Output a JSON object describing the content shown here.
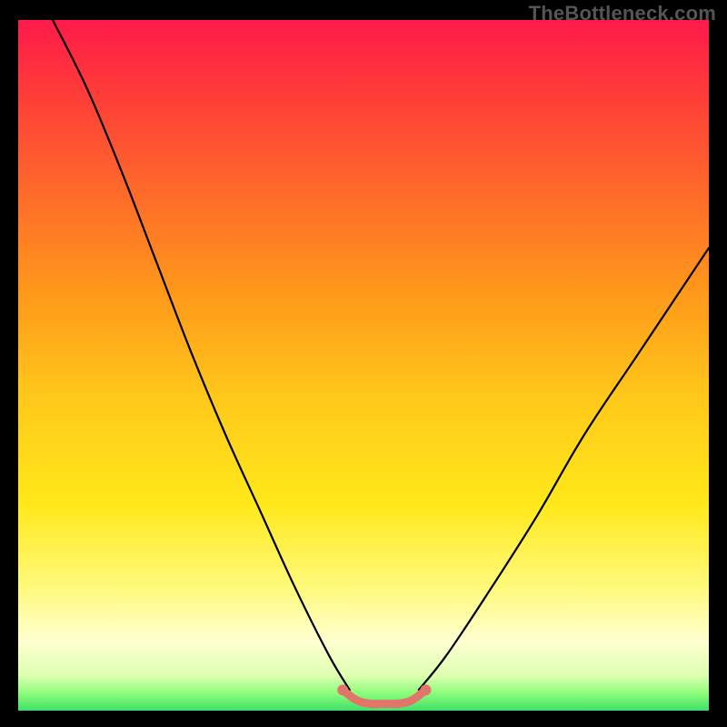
{
  "watermark": "TheBottleneck.com",
  "chart_data": {
    "type": "line",
    "title": "",
    "xlabel": "",
    "ylabel": "",
    "xlim": [
      0,
      100
    ],
    "ylim": [
      0,
      100
    ],
    "grid": false,
    "legend": false,
    "background_gradient": {
      "stops": [
        {
          "offset": 0.0,
          "color": "#ff1a4a"
        },
        {
          "offset": 0.1,
          "color": "#ff3a3a"
        },
        {
          "offset": 0.25,
          "color": "#ff6a2a"
        },
        {
          "offset": 0.4,
          "color": "#ff9a1a"
        },
        {
          "offset": 0.55,
          "color": "#ffc91a"
        },
        {
          "offset": 0.7,
          "color": "#ffe81a"
        },
        {
          "offset": 0.82,
          "color": "#fff97a"
        },
        {
          "offset": 0.9,
          "color": "#ffffd0"
        },
        {
          "offset": 0.95,
          "color": "#dcffb0"
        },
        {
          "offset": 0.975,
          "color": "#8dfc7a"
        },
        {
          "offset": 1.0,
          "color": "#3ee06a"
        }
      ]
    },
    "series": [
      {
        "name": "left-branch",
        "color": "#000000",
        "x": [
          5,
          10,
          15,
          20,
          25,
          30,
          35,
          40,
          45,
          48
        ],
        "values": [
          100,
          90,
          78,
          65,
          52,
          40,
          29,
          18,
          8,
          3
        ]
      },
      {
        "name": "right-branch",
        "color": "#000000",
        "x": [
          58,
          62,
          68,
          75,
          82,
          90,
          100
        ],
        "values": [
          3,
          8,
          17,
          28,
          40,
          52,
          67
        ]
      },
      {
        "name": "bottom-segment",
        "color": "#e2746a",
        "x": [
          47,
          49,
          51,
          53,
          55,
          57,
          59
        ],
        "values": [
          3,
          1.5,
          1,
          1,
          1,
          1.5,
          3
        ]
      }
    ],
    "markers": [
      {
        "x": 47,
        "y": 3,
        "color": "#e2746a"
      },
      {
        "x": 59,
        "y": 3,
        "color": "#e2746a"
      }
    ]
  }
}
